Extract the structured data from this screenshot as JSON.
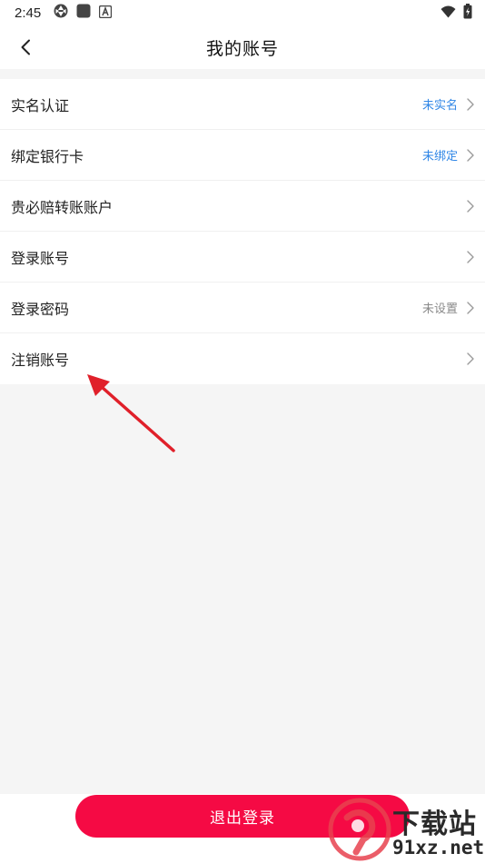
{
  "status_bar": {
    "time": "2:45"
  },
  "header": {
    "title": "我的账号"
  },
  "menu": [
    {
      "label": "实名认证",
      "value": "未实名",
      "value_color": "#2f86e6"
    },
    {
      "label": "绑定银行卡",
      "value": "未绑定",
      "value_color": "#2f86e6"
    },
    {
      "label": "贵必赔转账账户",
      "value": ""
    },
    {
      "label": "登录账号",
      "value": ""
    },
    {
      "label": "登录密码",
      "value": "未设置",
      "value_color": "#8a8a8a"
    },
    {
      "label": "注销账号",
      "value": ""
    }
  ],
  "footer": {
    "logout_label": "退出登录"
  },
  "watermark": {
    "top_text": "下载站",
    "bottom_text": "91xz.net"
  },
  "colors": {
    "accent": "#f50a44",
    "link_blue": "#2f86e6",
    "background": "#f5f5f5",
    "annotation_arrow": "#e0202a"
  },
  "icons": {
    "back": "chevron-left-icon",
    "row_arrow": "chevron-right-icon",
    "wifi": "wifi-icon",
    "battery": "battery-icon"
  }
}
